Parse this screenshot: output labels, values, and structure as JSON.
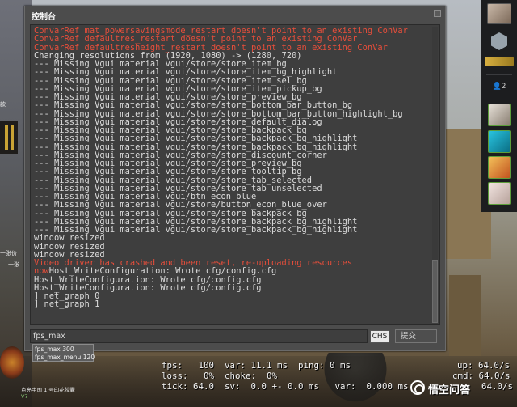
{
  "window": {
    "title": "控制台"
  },
  "console_lines": [
    {
      "text": "ConvarRef mat_powersavingsmode_restart doesn't point to an existing ConVar",
      "color": "#e74e3b"
    },
    {
      "text": "ConvarRef defaultres_restart doesn't point to an existing ConVar",
      "color": "#e74e3b"
    },
    {
      "text": "ConvarRef defaultresheight_restart doesn't point to an existing ConVar",
      "color": "#e74e3b"
    },
    {
      "text": "Changing resolutions from (1920, 1080) -> (1280, 720)",
      "color": "#dcdcdc"
    },
    {
      "text": "--- Missing Vgui material vgui/store/store_item_bg",
      "color": "#dcdcdc"
    },
    {
      "text": "--- Missing Vgui material vgui/store/store_item_bg_highlight",
      "color": "#dcdcdc"
    },
    {
      "text": "--- Missing Vgui material vgui/store/store_item_sel_bg",
      "color": "#dcdcdc"
    },
    {
      "text": "--- Missing Vgui material vgui/store/store_item_pickup_bg",
      "color": "#dcdcdc"
    },
    {
      "text": "--- Missing Vgui material vgui/store/store_preview_bg",
      "color": "#dcdcdc"
    },
    {
      "text": "--- Missing Vgui material vgui/store/store_bottom_bar_button_bg",
      "color": "#dcdcdc"
    },
    {
      "text": "--- Missing Vgui material vgui/store/store_bottom_bar_button_highlight_bg",
      "color": "#dcdcdc"
    },
    {
      "text": "--- Missing Vgui material vgui/store/store_default_dialog",
      "color": "#dcdcdc"
    },
    {
      "text": "--- Missing Vgui material vgui/store/store_backpack_bg",
      "color": "#dcdcdc"
    },
    {
      "text": "--- Missing Vgui material vgui/store/store_backpack_bg_highlight",
      "color": "#dcdcdc"
    },
    {
      "text": "--- Missing Vgui material vgui/store/store_backpack_bg_highlight",
      "color": "#dcdcdc"
    },
    {
      "text": "--- Missing Vgui material vgui/store/store_discount_corner",
      "color": "#dcdcdc"
    },
    {
      "text": "--- Missing Vgui material vgui/store/store_preview_bg",
      "color": "#dcdcdc"
    },
    {
      "text": "--- Missing Vgui material vgui/store/store_tooltip_bg",
      "color": "#dcdcdc"
    },
    {
      "text": "--- Missing Vgui material vgui/store/store_tab_selected",
      "color": "#dcdcdc"
    },
    {
      "text": "--- Missing Vgui material vgui/store/store_tab_unselected",
      "color": "#dcdcdc"
    },
    {
      "text": "--- Missing Vgui material vgui/btn_econ_blue",
      "color": "#dcdcdc"
    },
    {
      "text": "--- Missing Vgui material vgui/store/button_econ_blue_over",
      "color": "#dcdcdc"
    },
    {
      "text": "--- Missing Vgui material vgui/store/store_backpack_bg",
      "color": "#dcdcdc"
    },
    {
      "text": "--- Missing Vgui material vgui/store/store_backpack_bg_highlight",
      "color": "#dcdcdc"
    },
    {
      "text": "--- Missing Vgui material vgui/store/store_backpack_bg_highlight",
      "color": "#dcdcdc"
    },
    {
      "text": "window resized",
      "color": "#dcdcdc"
    },
    {
      "text": "window resized",
      "color": "#dcdcdc"
    },
    {
      "text": "window resized",
      "color": "#dcdcdc"
    },
    {
      "text": "Video driver has crashed and been reset, re-uploading resources",
      "color": "#e74e3b"
    },
    {
      "text": "Host_WriteConfiguration: Wrote cfg/config.cfg",
      "color": "#dcdcdc",
      "prefix": "now",
      "prefix_color": "#e74e3b"
    },
    {
      "text": "Host_WriteConfiguration: Wrote cfg/config.cfg",
      "color": "#dcdcdc"
    },
    {
      "text": "Host_WriteConfiguration: Wrote cfg/config.cfg",
      "color": "#dcdcdc"
    },
    {
      "text": "] net_graph 0",
      "color": "#dcdcdc"
    },
    {
      "text": "] net_graph 1",
      "color": "#dcdcdc"
    }
  ],
  "input": {
    "value": "fps_max"
  },
  "ime_indicator": "CHS",
  "submit_label": "提交",
  "autocomplete": [
    "fps_max 300",
    "fps_max_menu 120"
  ],
  "left_fragments": [
    "款",
    "一张价",
    "一张",
    "点亮中国 1 号印花胶囊",
    "V7"
  ],
  "sidebar": {
    "friends_count": "2",
    "icons": [
      "avatar",
      "rank-hex-icon",
      "weapon-icon",
      "friends-icon",
      "friend-avatar",
      "friend-avatar",
      "friend-avatar",
      "friend-avatar"
    ]
  },
  "netgraph": {
    "row1": "fps:   100  var: 11.1 ms  ping: 0 ms",
    "row2": "loss:   0%  choke:  0%",
    "row3": "tick: 64.0  sv:  0.0 +- 0.0 ms   var:  0.000 ms",
    "right1": "up: 64.0/s",
    "right2": "cmd: 64.0/s",
    "right3": "64.0/s"
  },
  "watermark": "悟空问答"
}
